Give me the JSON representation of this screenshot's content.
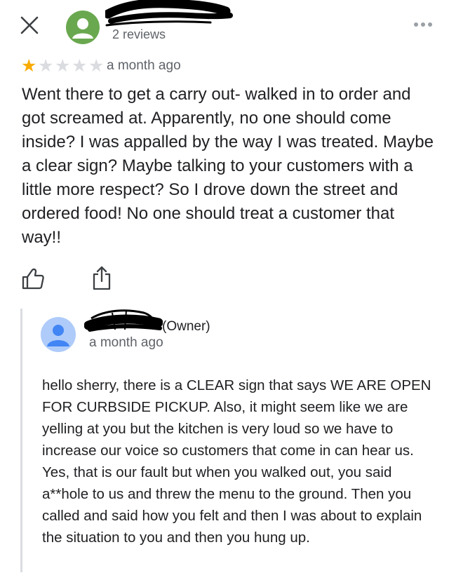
{
  "review": {
    "reviewer_name": "",
    "reviews_count": "2 reviews",
    "rating": 1,
    "max_rating": 5,
    "time_ago": "a month ago",
    "text": "Went there to get a carry out- walked in to order and got screamed at.  Apparently, no one should come inside? I was appalled by the way I was treated. Maybe a clear sign? Maybe talking to your customers with a little more respect?  So I drove down the street and ordered food!  No one should treat a customer that way!!"
  },
  "owner_reply": {
    "owner_name": "",
    "owner_tag": "(Owner)",
    "time_ago": "a month ago",
    "text": "hello sherry, there is a CLEAR sign that says WE ARE OPEN FOR CURBSIDE PICKUP. Also, it might seem like we are yelling at you but the kitchen is very loud so we have to increase our voice so customers that come in can hear us. Yes, that is our fault but when you walked out, you said a**hole to us and threw the menu to the ground. Then you called and said how you felt and then I was about to explain the situation to you and then you hung up."
  },
  "colors": {
    "star_filled": "#f9ab00",
    "star_empty": "#dadce0",
    "avatar_reviewer": "#6aa84f",
    "avatar_owner": "#aecbfa",
    "text_primary": "#202124",
    "text_secondary": "#5f6368"
  },
  "icons": [
    "close-icon",
    "more-options-icon",
    "star-icon",
    "thumbs-up-icon",
    "share-icon",
    "person-icon"
  ]
}
